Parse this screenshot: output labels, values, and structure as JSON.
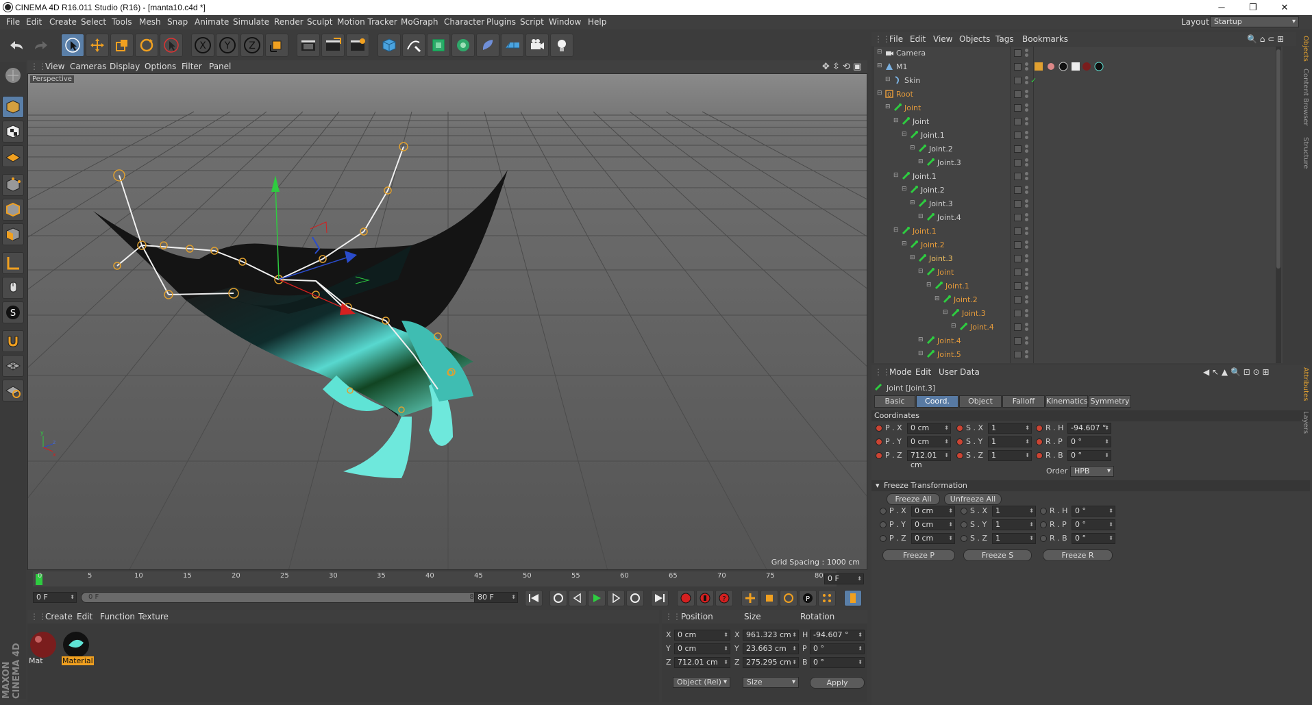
{
  "window": {
    "title": "CINEMA 4D R16.011 Studio (R16) - [manta10.c4d *]",
    "minimize": "─",
    "maximize": "❐",
    "close": "✕"
  },
  "menu": [
    "File",
    "Edit",
    "Create",
    "Select",
    "Tools",
    "Mesh",
    "Snap",
    "Animate",
    "Simulate",
    "Render",
    "Sculpt",
    "Motion Tracker",
    "MoGraph",
    "Character",
    "Plugins",
    "Script",
    "Window",
    "Help"
  ],
  "layout": {
    "label": "Layout:",
    "value": "Startup"
  },
  "toolbar": {
    "x_label": "X",
    "y_label": "Y",
    "z_label": "Z"
  },
  "viewport_menu": [
    "View",
    "Cameras",
    "Display",
    "Options",
    "Filter",
    "Panel"
  ],
  "viewport": {
    "label": "Perspective",
    "grid_spacing": "Grid Spacing : 1000 cm"
  },
  "timeline": {
    "ticks": [
      "0",
      "5",
      "10",
      "15",
      "20",
      "25",
      "30",
      "35",
      "40",
      "45",
      "50",
      "55",
      "60",
      "65",
      "70",
      "75",
      "80"
    ],
    "current_frame": "0 F",
    "start_frame": "0 F",
    "range_start": "0 F",
    "range_end": "80 F",
    "end_frame": "80 F"
  },
  "object_manager": {
    "menu": [
      "File",
      "Edit",
      "View",
      "Objects",
      "Tags",
      "Bookmarks"
    ],
    "items": [
      {
        "name": "Camera",
        "depth": 0,
        "color": "#d0d0d0"
      },
      {
        "name": "M1",
        "depth": 0,
        "color": "#d0d0d0"
      },
      {
        "name": "Skin",
        "depth": 1,
        "color": "#d0d0d0"
      },
      {
        "name": "Root",
        "depth": 0,
        "color": "#e39a3c"
      },
      {
        "name": "Joint",
        "depth": 1,
        "color": "#e39a3c"
      },
      {
        "name": "Joint",
        "depth": 2,
        "color": "#d0d0d0"
      },
      {
        "name": "Joint.1",
        "depth": 3,
        "color": "#d0d0d0"
      },
      {
        "name": "Joint.2",
        "depth": 4,
        "color": "#d0d0d0"
      },
      {
        "name": "Joint.3",
        "depth": 5,
        "color": "#d0d0d0"
      },
      {
        "name": "Joint.1",
        "depth": 2,
        "color": "#d0d0d0"
      },
      {
        "name": "Joint.2",
        "depth": 3,
        "color": "#d0d0d0"
      },
      {
        "name": "Joint.3",
        "depth": 4,
        "color": "#d0d0d0"
      },
      {
        "name": "Joint.4",
        "depth": 5,
        "color": "#d0d0d0"
      },
      {
        "name": "Joint.1",
        "depth": 2,
        "color": "#e39a3c"
      },
      {
        "name": "Joint.2",
        "depth": 3,
        "color": "#e39a3c"
      },
      {
        "name": "Joint.3",
        "depth": 4,
        "color": "#f0c060"
      },
      {
        "name": "Joint",
        "depth": 5,
        "color": "#e39a3c"
      },
      {
        "name": "Joint.1",
        "depth": 6,
        "color": "#e39a3c"
      },
      {
        "name": "Joint.2",
        "depth": 7,
        "color": "#e39a3c"
      },
      {
        "name": "Joint.3",
        "depth": 8,
        "color": "#e39a3c"
      },
      {
        "name": "Joint.4",
        "depth": 9,
        "color": "#e39a3c"
      },
      {
        "name": "Joint.4",
        "depth": 5,
        "color": "#e39a3c"
      },
      {
        "name": "Joint.5",
        "depth": 5,
        "color": "#e39a3c"
      }
    ]
  },
  "attributes": {
    "menu": [
      "Mode",
      "Edit",
      "User Data"
    ],
    "object_label": "Joint [Joint.3]",
    "tabs": [
      "Basic",
      "Coord.",
      "Object",
      "Falloff",
      "Kinematics",
      "Symmetry"
    ],
    "section": "Coordinates",
    "rows": [
      {
        "p_label": "P . X",
        "p_val": "0 cm",
        "s_label": "S . X",
        "s_val": "1",
        "r_label": "R . H",
        "r_val": "-94.607 °"
      },
      {
        "p_label": "P . Y",
        "p_val": "0 cm",
        "s_label": "S . Y",
        "s_val": "1",
        "r_label": "R . P",
        "r_val": "0 °"
      },
      {
        "p_label": "P . Z",
        "p_val": "712.01 cm",
        "s_label": "S . Z",
        "s_val": "1",
        "r_label": "R . B",
        "r_val": "0 °"
      }
    ],
    "order_label": "Order",
    "order_value": "HPB",
    "freeze_section": "Freeze Transformation",
    "freeze_all": "Freeze All",
    "unfreeze_all": "Unfreeze All",
    "frows": [
      {
        "p_label": "P . X",
        "p_val": "0 cm",
        "s_label": "S . X",
        "s_val": "1",
        "r_label": "R . H",
        "r_val": "0 °"
      },
      {
        "p_label": "P . Y",
        "p_val": "0 cm",
        "s_label": "S . Y",
        "s_val": "1",
        "r_label": "R . P",
        "r_val": "0 °"
      },
      {
        "p_label": "P . Z",
        "p_val": "0 cm",
        "s_label": "S . Z",
        "s_val": "1",
        "r_label": "R . B",
        "r_val": "0 °"
      }
    ],
    "freeze_p": "Freeze P",
    "freeze_s": "Freeze S",
    "freeze_r": "Freeze R"
  },
  "material_manager": {
    "menu": [
      "Create",
      "Edit",
      "Function",
      "Texture"
    ],
    "materials": [
      "Mat",
      "Material"
    ]
  },
  "coordinates": {
    "headers": [
      "Position",
      "Size",
      "Rotation"
    ],
    "rows": [
      {
        "axis": "X",
        "pos": "0 cm",
        "saxis": "X",
        "size": "961.323 cm",
        "raxis": "H",
        "rot": "-94.607 °"
      },
      {
        "axis": "Y",
        "pos": "0 cm",
        "saxis": "Y",
        "size": "23.663 cm",
        "raxis": "P",
        "rot": "0 °"
      },
      {
        "axis": "Z",
        "pos": "712.01 cm",
        "saxis": "Z",
        "size": "275.295 cm",
        "raxis": "B",
        "rot": "0 °"
      }
    ],
    "mode": "Object (Rel)",
    "size_mode": "Size",
    "apply": "Apply"
  },
  "side_tabs": [
    "Objects",
    "Content Browser",
    "Structure"
  ],
  "attr_side_tabs": [
    "Attributes",
    "Layers"
  ],
  "brand": "MAXON CINEMA 4D"
}
